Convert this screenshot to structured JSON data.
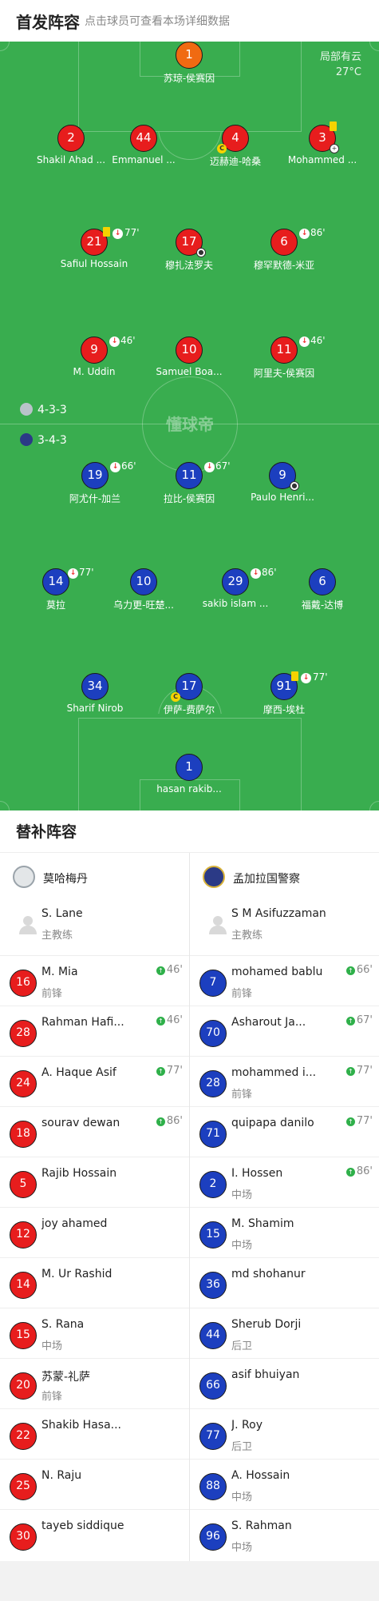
{
  "header": {
    "title": "首发阵容",
    "subtitle": "点击球员可查看本场详细数据"
  },
  "weather": {
    "condition": "局部有云",
    "temp": "27°C"
  },
  "watermark": "懂球帝",
  "formations": {
    "home": "4-3-3",
    "away": "3-4-3"
  },
  "colors": {
    "pitch": "#39ad4f",
    "home": "#e71d1d",
    "away": "#1c3fbf",
    "keeper": "#f06a12",
    "sub_in": "#2fb04a"
  },
  "lineup_home": [
    {
      "num": "1",
      "name": "苏琼-侯赛因"
    },
    {
      "num": "2",
      "name": "Shakil Ahad ..."
    },
    {
      "num": "44",
      "name": "Emmanuel ..."
    },
    {
      "num": "4",
      "name": "迈赫迪-哈桑"
    },
    {
      "num": "3",
      "name": "Mohammed ..."
    },
    {
      "num": "21",
      "name": "Safiul Hossain",
      "min": "77'"
    },
    {
      "num": "17",
      "name": "穆扎法罗夫"
    },
    {
      "num": "6",
      "name": "穆罕默德-米亚",
      "min": "86'"
    },
    {
      "num": "9",
      "name": "M. Uddin",
      "min": "46'"
    },
    {
      "num": "10",
      "name": "Samuel Boa..."
    },
    {
      "num": "11",
      "name": "阿里夫-侯赛因",
      "min": "46'"
    }
  ],
  "lineup_away": [
    {
      "num": "19",
      "name": "阿尤什-加兰",
      "min": "66'"
    },
    {
      "num": "11",
      "name": "拉比-侯赛因",
      "min": "67'"
    },
    {
      "num": "9",
      "name": "Paulo Henri..."
    },
    {
      "num": "14",
      "name": "莫拉",
      "min": "77'"
    },
    {
      "num": "10",
      "name": "乌力更-旺楚..."
    },
    {
      "num": "29",
      "name": "sakib islam ...",
      "min": "86'"
    },
    {
      "num": "6",
      "name": "福戴-达博"
    },
    {
      "num": "34",
      "name": "Sharif Nirob"
    },
    {
      "num": "17",
      "name": "伊萨-费萨尔"
    },
    {
      "num": "91",
      "name": "摩西-埃杜",
      "min": "77'"
    },
    {
      "num": "1",
      "name": "hasan rakib..."
    }
  ],
  "bench": {
    "title": "替补阵容",
    "home": {
      "team": "莫哈梅丹",
      "coach": {
        "name": "S. Lane",
        "role": "主教练"
      },
      "players": [
        {
          "num": "16",
          "name": "M. Mia",
          "pos": "前锋",
          "sub": "46'"
        },
        {
          "num": "28",
          "name": "Rahman Hafi...",
          "pos": "",
          "sub": "46'"
        },
        {
          "num": "24",
          "name": "A. Haque Asif",
          "pos": "",
          "sub": "77'"
        },
        {
          "num": "18",
          "name": "sourav dewan",
          "pos": "",
          "sub": "86'"
        },
        {
          "num": "5",
          "name": "Rajib Hossain",
          "pos": "",
          "sub": ""
        },
        {
          "num": "12",
          "name": "joy ahamed",
          "pos": "",
          "sub": ""
        },
        {
          "num": "14",
          "name": "M. Ur Rashid",
          "pos": "",
          "sub": ""
        },
        {
          "num": "15",
          "name": "S. Rana",
          "pos": "中场",
          "sub": ""
        },
        {
          "num": "20",
          "name": "苏蒙-礼萨",
          "pos": "前锋",
          "sub": ""
        },
        {
          "num": "22",
          "name": "Shakib Hasa...",
          "pos": "",
          "sub": ""
        },
        {
          "num": "25",
          "name": "N. Raju",
          "pos": "",
          "sub": ""
        },
        {
          "num": "30",
          "name": "tayeb siddique",
          "pos": "",
          "sub": ""
        }
      ]
    },
    "away": {
      "team": "孟加拉国警察",
      "coach": {
        "name": "S M Asifuzzaman",
        "role": "主教练"
      },
      "players": [
        {
          "num": "7",
          "name": "mohamed bablu",
          "pos": "前锋",
          "sub": "66'"
        },
        {
          "num": "70",
          "name": "Asharout Ja...",
          "pos": "",
          "sub": "67'"
        },
        {
          "num": "28",
          "name": "mohammed i...",
          "pos": "前锋",
          "sub": "77'"
        },
        {
          "num": "71",
          "name": "quipapa danilo",
          "pos": "",
          "sub": "77'"
        },
        {
          "num": "2",
          "name": "I. Hossen",
          "pos": "中场",
          "sub": "86'"
        },
        {
          "num": "15",
          "name": "M. Shamim",
          "pos": "中场",
          "sub": ""
        },
        {
          "num": "36",
          "name": "md shohanur",
          "pos": "",
          "sub": ""
        },
        {
          "num": "44",
          "name": "Sherub Dorji",
          "pos": "后卫",
          "sub": ""
        },
        {
          "num": "66",
          "name": "asif bhuiyan",
          "pos": "",
          "sub": ""
        },
        {
          "num": "77",
          "name": "J. Roy",
          "pos": "后卫",
          "sub": ""
        },
        {
          "num": "88",
          "name": "A. Hossain",
          "pos": "中场",
          "sub": ""
        },
        {
          "num": "96",
          "name": "S. Rahman",
          "pos": "中场",
          "sub": ""
        }
      ]
    }
  }
}
